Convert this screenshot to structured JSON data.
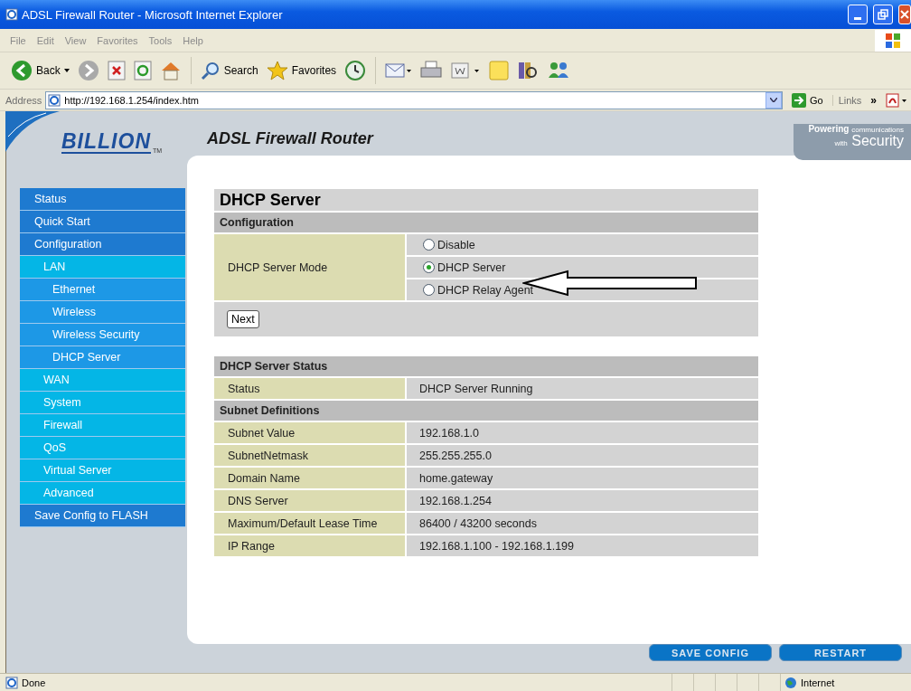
{
  "window": {
    "title": "ADSL Firewall Router - Microsoft Internet Explorer"
  },
  "menu": [
    "File",
    "Edit",
    "View",
    "Favorites",
    "Tools",
    "Help"
  ],
  "toolbar": [
    {
      "kind": "back",
      "label": "Back"
    },
    {
      "kind": "forward"
    },
    {
      "kind": "stop"
    },
    {
      "kind": "refresh"
    },
    {
      "kind": "home"
    },
    {
      "kind": "search",
      "label": "Search"
    },
    {
      "kind": "favorites",
      "label": "Favorites"
    },
    {
      "kind": "history"
    },
    {
      "kind": "mail"
    },
    {
      "kind": "print"
    },
    {
      "kind": "edit"
    },
    {
      "kind": "note"
    },
    {
      "kind": "research"
    },
    {
      "kind": "messenger"
    }
  ],
  "address_bar": {
    "label": "Address",
    "value": "http://192.168.1.254/index.htm",
    "go": "Go",
    "links": "Links",
    "chevron": "»"
  },
  "header": {
    "logo": "BILLION",
    "trademark": "TM",
    "title": "ADSL Firewall Router",
    "tagline_top": "Powering",
    "tagline_top_small": "communications",
    "tagline_bottom_small": "with",
    "tagline_bottom": "Security"
  },
  "sidebar": [
    {
      "label": "Status"
    },
    {
      "label": "Quick Start"
    },
    {
      "label": "Configuration",
      "children": [
        {
          "label": "LAN",
          "children": [
            {
              "label": "Ethernet"
            },
            {
              "label": "Wireless"
            },
            {
              "label": "Wireless Security"
            },
            {
              "label": "DHCP Server"
            }
          ]
        },
        {
          "label": "WAN"
        },
        {
          "label": "System"
        },
        {
          "label": "Firewall"
        },
        {
          "label": "QoS"
        },
        {
          "label": "Virtual Server"
        },
        {
          "label": "Advanced"
        }
      ]
    },
    {
      "label": "Save Config to FLASH"
    }
  ],
  "page": {
    "title": "DHCP Server",
    "config_heading": "Configuration",
    "mode_label": "DHCP Server Mode",
    "mode_options": [
      {
        "label": "Disable",
        "selected": false
      },
      {
        "label": "DHCP Server",
        "selected": true
      },
      {
        "label": "DHCP Relay Agent",
        "selected": false
      }
    ],
    "next": "Next",
    "status_heading": "DHCP Server Status",
    "status_rows": [
      {
        "label": "Status",
        "value": "DHCP Server Running"
      }
    ],
    "subnet_heading": "Subnet Definitions",
    "subnet_rows": [
      {
        "label": "Subnet Value",
        "value": "192.168.1.0"
      },
      {
        "label": "SubnetNetmask",
        "value": "255.255.255.0"
      },
      {
        "label": "Domain Name",
        "value": "home.gateway"
      },
      {
        "label": "DNS Server",
        "value": "192.168.1.254"
      },
      {
        "label": "Maximum/Default Lease Time",
        "value": "86400 / 43200 seconds"
      },
      {
        "label": "IP Range",
        "value": "192.168.1.100 - 192.168.1.199"
      }
    ]
  },
  "footer_buttons": [
    "SAVE CONFIG",
    "RESTART"
  ],
  "status_bar": {
    "text": "Done",
    "zone": "Internet"
  }
}
